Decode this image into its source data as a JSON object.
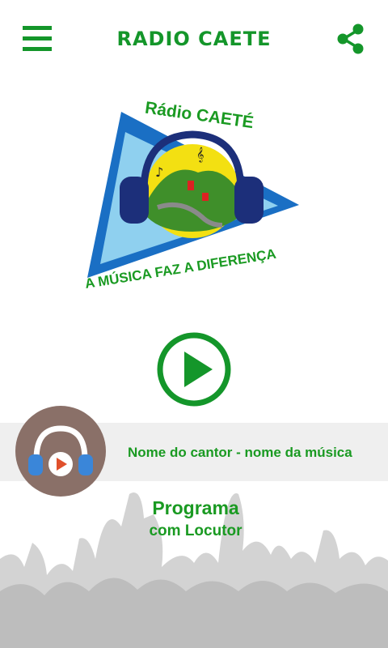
{
  "header": {
    "title": "RADIO CAETE",
    "menu_icon": "hamburger-menu-icon",
    "share_icon": "share-icon",
    "accent_color": "#14962a"
  },
  "logo": {
    "station_name": "Rádio CAETÉ",
    "slogan": "A MÚSICA FAZ A DIFERENÇA"
  },
  "player": {
    "play_icon": "play-circle-icon",
    "track_title": "Nome do cantor - nome da música",
    "avatar_icon": "headphones-icon",
    "program": "Programa",
    "host": "com Locutor"
  }
}
